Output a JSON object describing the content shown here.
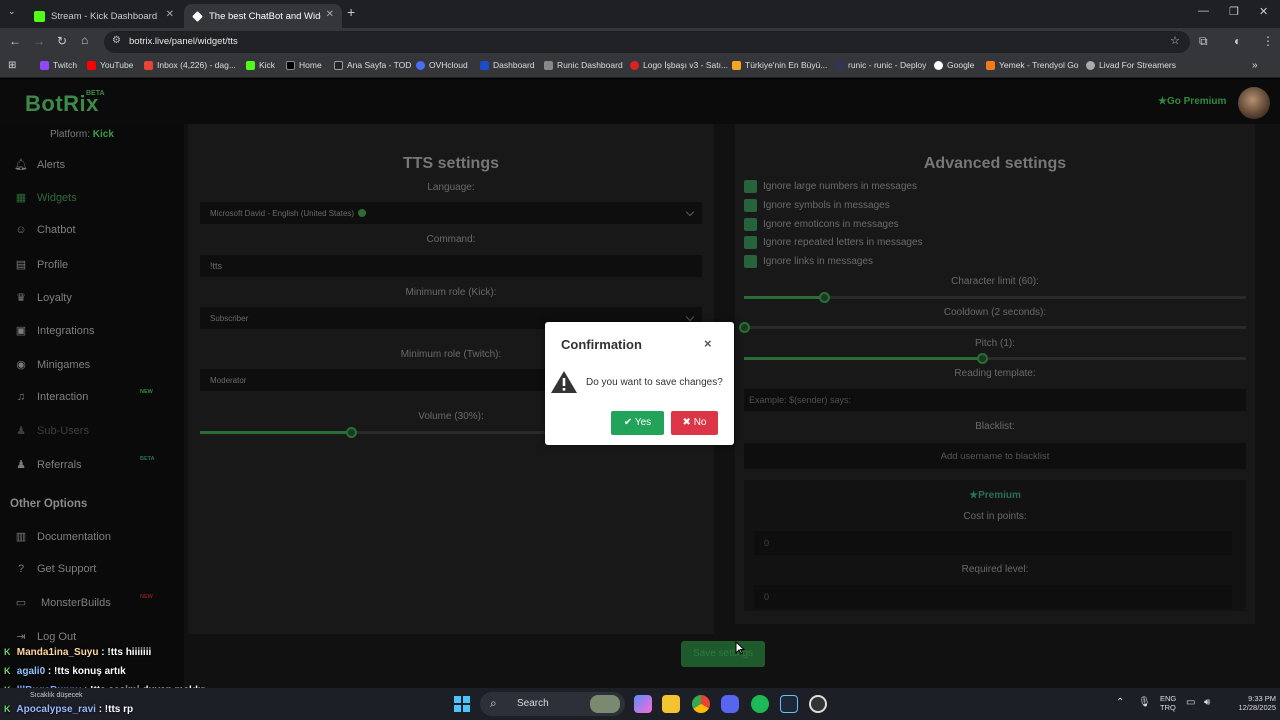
{
  "browser": {
    "tabs": [
      {
        "label": "Stream - Kick Dashboard",
        "active": false
      },
      {
        "label": "The best ChatBot and Widgets",
        "active": true
      }
    ],
    "url": "botrix.live/panel/widget/tts",
    "bookmarks": [
      "Twitch",
      "YouTube",
      "Inbox (4,226) - dag...",
      "Kick",
      "Home",
      "Ana Sayfa - TOD",
      "OVHcloud",
      "Dashboard",
      "Runic Dashboard",
      "Logo İşbaşı v3 - Satı...",
      "Türkiye'nin En Büyü...",
      "runic - runic - Deploy",
      "Google",
      "Yemek - Trendyol Go",
      "Livad For Streamers"
    ]
  },
  "header": {
    "logo": "BotRix",
    "beta": "BETA",
    "go_premium": "Go Premium"
  },
  "sidebar": {
    "platform_label": "Platform:",
    "platform_value": "Kick",
    "items": [
      {
        "label": "Alerts",
        "icon": "bell-icon"
      },
      {
        "label": "Widgets",
        "icon": "grid-icon"
      },
      {
        "label": "Chatbot",
        "icon": "robot-icon"
      },
      {
        "label": "Profile",
        "icon": "id-card-icon"
      },
      {
        "label": "Loyalty",
        "icon": "trophy-icon"
      },
      {
        "label": "Integrations",
        "icon": "plug-icon"
      },
      {
        "label": "Minigames",
        "icon": "gamepad-icon"
      },
      {
        "label": "Interaction",
        "icon": "music-icon",
        "tag": "NEW"
      },
      {
        "label": "Sub-Users",
        "icon": "users-icon"
      },
      {
        "label": "Referrals",
        "icon": "users-icon",
        "tag": "BETA"
      }
    ],
    "other_options_title": "Other Options",
    "other_items": [
      {
        "label": "Documentation",
        "icon": "book-icon"
      },
      {
        "label": "Get Support",
        "icon": "question-icon"
      },
      {
        "label": "MonsterBuilds",
        "icon": "laptop-icon",
        "tag": "NEW"
      },
      {
        "label": "Log Out",
        "icon": "logout-icon"
      }
    ]
  },
  "tts": {
    "title": "TTS settings",
    "language_label": "Language:",
    "language_value": "Microsoft David - English (United States)",
    "command_label": "Command:",
    "command_value": "!tts",
    "min_role_kick_label": "Minimum role (Kick):",
    "min_role_kick_value": "Subscriber",
    "min_role_twitch_label": "Minimum role (Twitch):",
    "min_role_twitch_value": "Moderator",
    "volume_label": "Volume (30%):",
    "volume_fraction": 0.3
  },
  "advanced": {
    "title": "Advanced settings",
    "checkboxes": [
      "Ignore large numbers in messages",
      "Ignore symbols in messages",
      "Ignore emoticons in messages",
      "Ignore repeated letters in messages",
      "Ignore links in messages"
    ],
    "char_limit_label": "Character limit (60):",
    "cooldown_label": "Cooldown (2 seconds):",
    "pitch_label": "Pitch (1):",
    "reading_template_label": "Reading template:",
    "reading_template_placeholder": "Example: $(sender) says:",
    "blacklist_label": "Blacklist:",
    "blacklist_placeholder": "Add username to blacklist",
    "premium_label": "Premium",
    "cost_label": "Cost in points:",
    "cost_value": "0",
    "required_level_label": "Required level:",
    "required_level_value": "0"
  },
  "save_button": "Save settings",
  "modal": {
    "title": "Confirmation",
    "close": "×",
    "message": "Do you want to save changes?",
    "yes": "Yes",
    "no": "No"
  },
  "chat": [
    {
      "user": "Manda1ina_Suyu",
      "msg": " : !tts hiiiiiii"
    },
    {
      "user": "agali0",
      "msg": " : !tts konuş artık"
    },
    {
      "user": "lllBugsBunny",
      "msg": " : !tts sesimi duyan maldır"
    },
    {
      "user": "Apocalypse_ravi",
      "msg": " : !tts rp"
    }
  ],
  "taskbar": {
    "search": "Search",
    "weather_line1": "Sıcaklık düşecek",
    "lang1": "ENG",
    "lang2": "TRQ",
    "time": "9:33 PM",
    "date": "12/28/2025"
  }
}
